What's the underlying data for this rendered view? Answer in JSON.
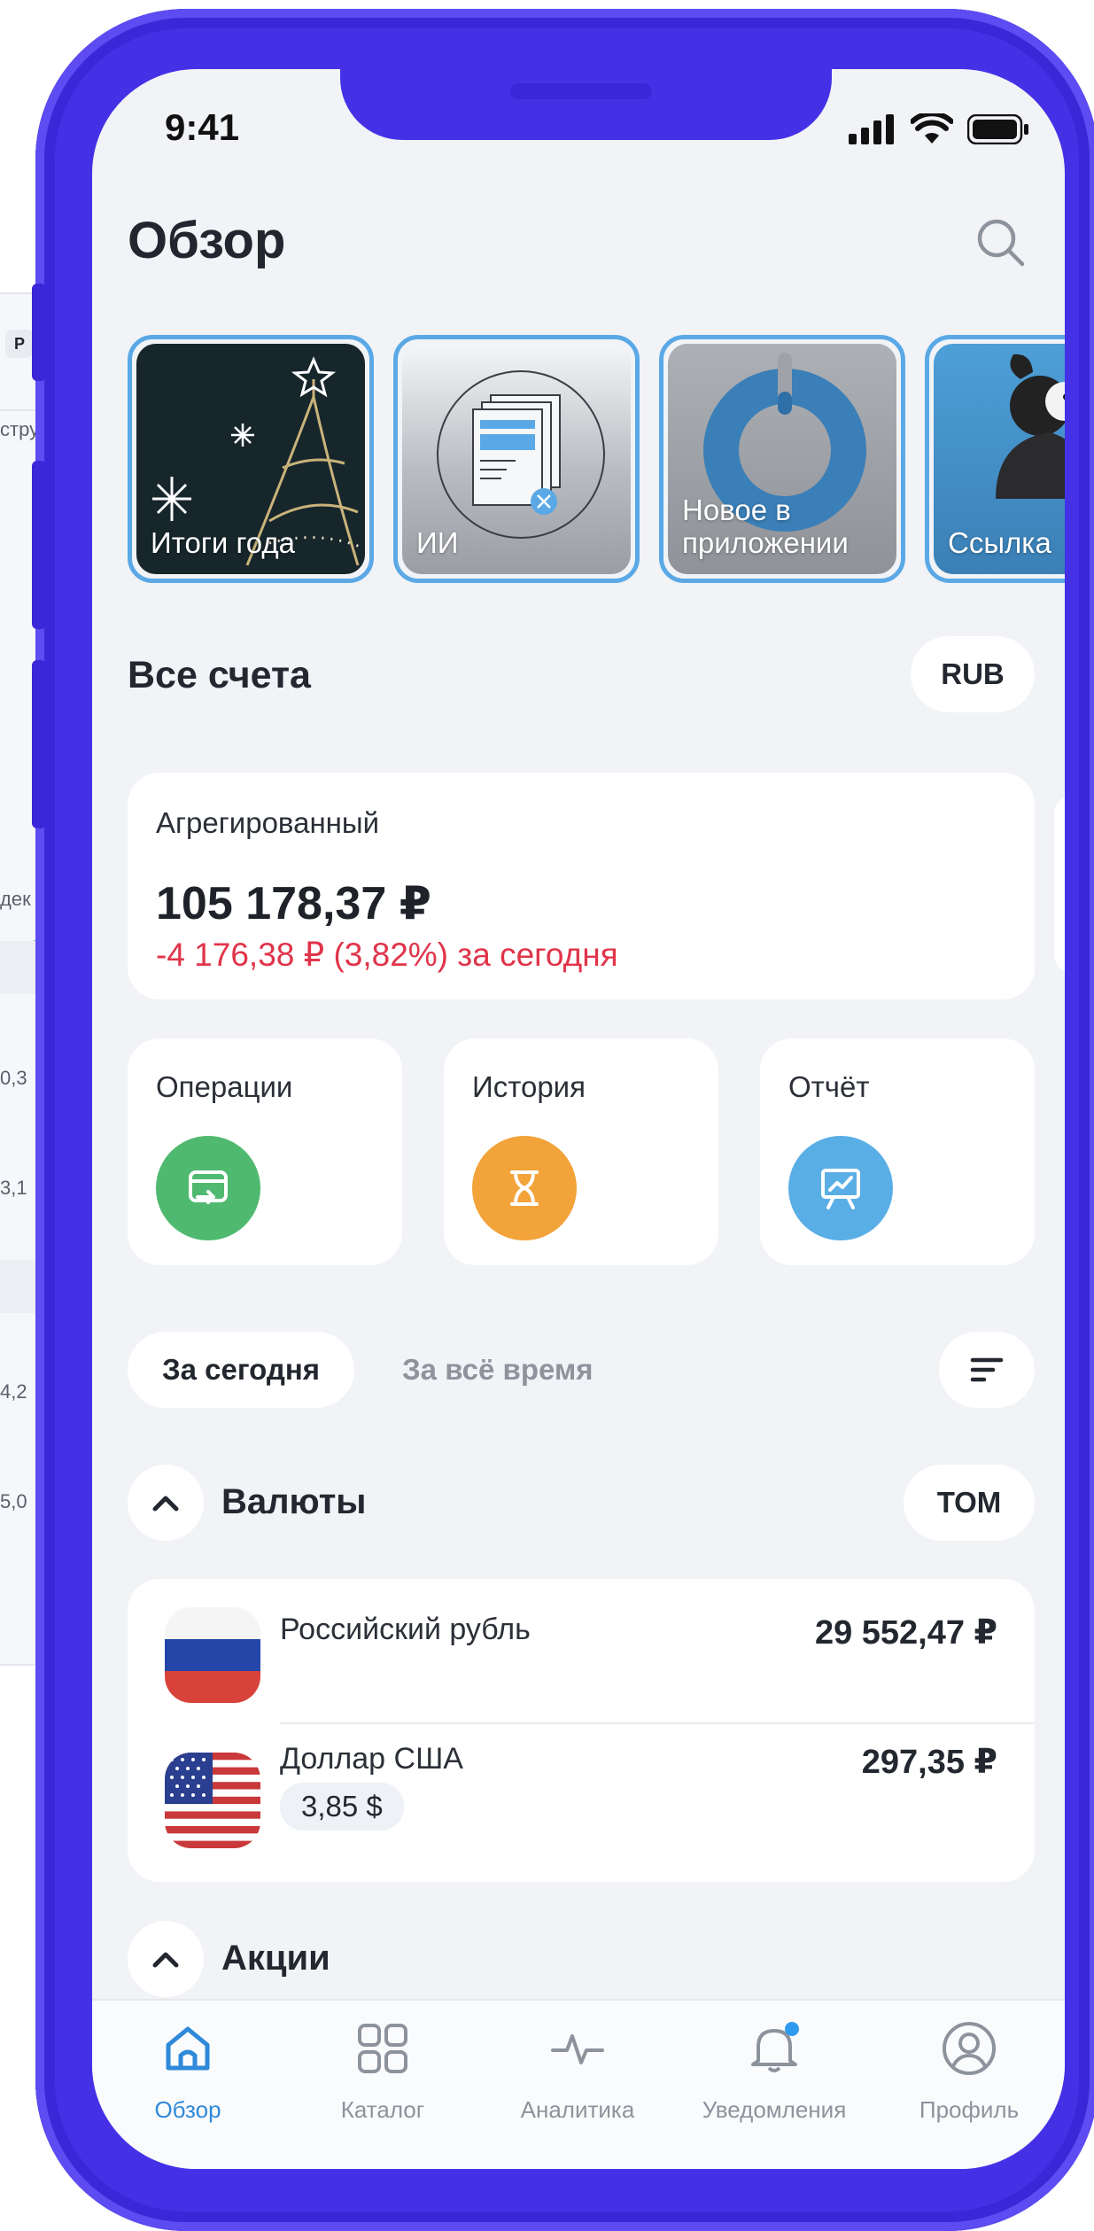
{
  "background": {
    "fragments": [
      "P",
      "стру",
      "дек",
      "0,3",
      "3,1",
      "4,2",
      "5,0"
    ]
  },
  "status_bar": {
    "time": "9:41"
  },
  "header": {
    "title": "Обзор"
  },
  "stories": [
    {
      "label": "Итоги года"
    },
    {
      "label": "ИИ"
    },
    {
      "label": "Новое в приложении"
    },
    {
      "label": "Ссылка"
    }
  ],
  "accounts": {
    "title": "Все счета",
    "currency_button": "RUB",
    "aggregated": {
      "label": "Агрегированный",
      "amount": "105 178,37 ₽",
      "change": "-4 176,38 ₽ (3,82%) за сегодня"
    }
  },
  "quick_actions": [
    {
      "label": "Операции",
      "color": "#4fba6f"
    },
    {
      "label": "История",
      "color": "#f2a33a"
    },
    {
      "label": "Отчёт",
      "color": "#5aaee6"
    }
  ],
  "period_tabs": {
    "today": "За сегодня",
    "all_time": "За всё время"
  },
  "currencies": {
    "title": "Валюты",
    "mode_button": "ТОМ",
    "items": [
      {
        "name": "Российский рубль",
        "value": "29 552,47 ₽"
      },
      {
        "name": "Доллар США",
        "value": "297,35 ₽",
        "native": "3,85 $"
      }
    ]
  },
  "stocks": {
    "title": "Акции"
  },
  "tabbar": [
    {
      "label": "Обзор",
      "active": true
    },
    {
      "label": "Каталог"
    },
    {
      "label": "Аналитика"
    },
    {
      "label": "Уведомления"
    },
    {
      "label": "Профиль"
    }
  ],
  "colors": {
    "accent": "#2f89d9",
    "negative": "#e0344a",
    "frame": "#4431e6",
    "notification_dot": "#2f9bef"
  }
}
